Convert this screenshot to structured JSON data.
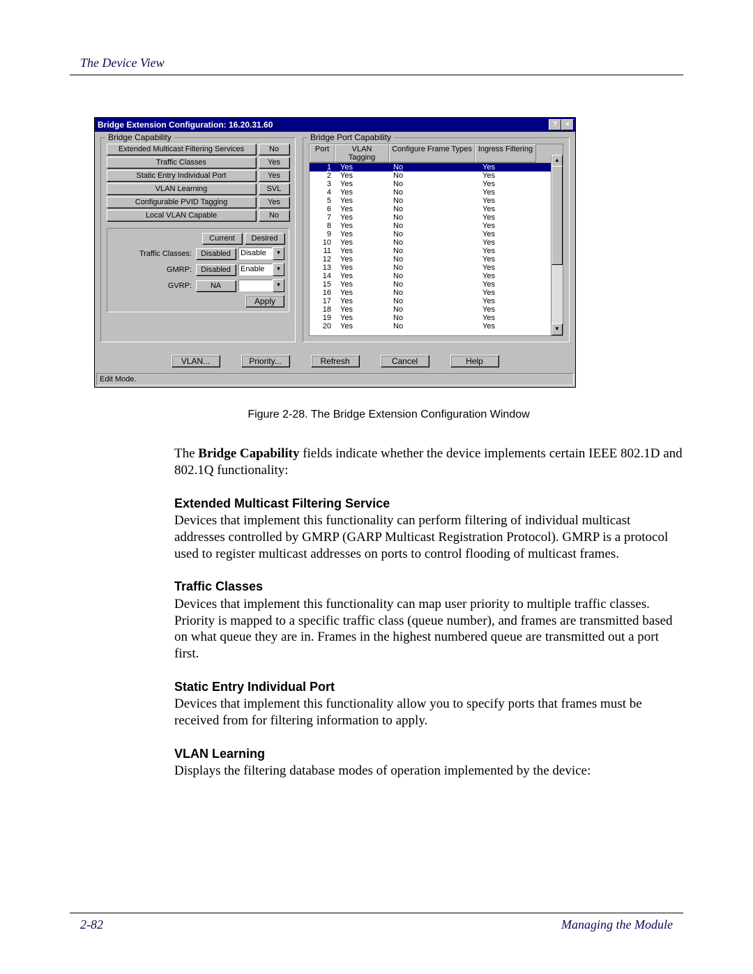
{
  "header": "The Device View",
  "window": {
    "title": "Bridge Extension Configuration: 16.20.31.60",
    "help_btn": "?",
    "close_btn": "×",
    "left_group": "Bridge Capability",
    "right_group": "Bridge Port Capability",
    "capabilities": [
      {
        "label": "Extended Multicast Filtering Services",
        "value": "No"
      },
      {
        "label": "Traffic Classes",
        "value": "Yes"
      },
      {
        "label": "Static Entry Individual Port",
        "value": "Yes"
      },
      {
        "label": "VLAN Learning",
        "value": "SVL"
      },
      {
        "label": "Configurable PVID Tagging",
        "value": "Yes"
      },
      {
        "label": "Local VLAN Capable",
        "value": "No"
      }
    ],
    "settings_hdr_current": "Current",
    "settings_hdr_desired": "Desired",
    "settings": [
      {
        "label": "Traffic Classes:",
        "current": "Disabled",
        "desired": "Disable"
      },
      {
        "label": "GMRP:",
        "current": "Disabled",
        "desired": "Enable"
      },
      {
        "label": "GVRP:",
        "current": "NA",
        "desired": ""
      }
    ],
    "apply_btn": "Apply",
    "port_headers": {
      "port": "Port",
      "tag": "VLAN Tagging",
      "cfg": "Configure Frame Types",
      "ing": "Ingress Filtering"
    },
    "ports": [
      {
        "port": "1",
        "tag": "Yes",
        "cfg": "No",
        "ing": "Yes",
        "selected": true
      },
      {
        "port": "2",
        "tag": "Yes",
        "cfg": "No",
        "ing": "Yes"
      },
      {
        "port": "3",
        "tag": "Yes",
        "cfg": "No",
        "ing": "Yes"
      },
      {
        "port": "4",
        "tag": "Yes",
        "cfg": "No",
        "ing": "Yes"
      },
      {
        "port": "5",
        "tag": "Yes",
        "cfg": "No",
        "ing": "Yes"
      },
      {
        "port": "6",
        "tag": "Yes",
        "cfg": "No",
        "ing": "Yes"
      },
      {
        "port": "7",
        "tag": "Yes",
        "cfg": "No",
        "ing": "Yes"
      },
      {
        "port": "8",
        "tag": "Yes",
        "cfg": "No",
        "ing": "Yes"
      },
      {
        "port": "9",
        "tag": "Yes",
        "cfg": "No",
        "ing": "Yes"
      },
      {
        "port": "10",
        "tag": "Yes",
        "cfg": "No",
        "ing": "Yes"
      },
      {
        "port": "11",
        "tag": "Yes",
        "cfg": "No",
        "ing": "Yes"
      },
      {
        "port": "12",
        "tag": "Yes",
        "cfg": "No",
        "ing": "Yes"
      },
      {
        "port": "13",
        "tag": "Yes",
        "cfg": "No",
        "ing": "Yes"
      },
      {
        "port": "14",
        "tag": "Yes",
        "cfg": "No",
        "ing": "Yes"
      },
      {
        "port": "15",
        "tag": "Yes",
        "cfg": "No",
        "ing": "Yes"
      },
      {
        "port": "16",
        "tag": "Yes",
        "cfg": "No",
        "ing": "Yes"
      },
      {
        "port": "17",
        "tag": "Yes",
        "cfg": "No",
        "ing": "Yes"
      },
      {
        "port": "18",
        "tag": "Yes",
        "cfg": "No",
        "ing": "Yes"
      },
      {
        "port": "19",
        "tag": "Yes",
        "cfg": "No",
        "ing": "Yes"
      },
      {
        "port": "20",
        "tag": "Yes",
        "cfg": "No",
        "ing": "Yes"
      }
    ],
    "buttons": {
      "vlan": "VLAN...",
      "priority": "Priority...",
      "refresh": "Refresh",
      "cancel": "Cancel",
      "help": "Help"
    },
    "status": "Edit Mode."
  },
  "figure_caption": "Figure 2-28. The Bridge Extension Configuration Window",
  "text": {
    "intro1": "The ",
    "intro_bold": "Bridge Capability",
    "intro2": " fields indicate whether the device implements certain IEEE 802.1D and 802.1Q functionality:",
    "h1": "Extended Multicast Filtering Service",
    "p1": "Devices that implement this functionality can perform filtering of individual multicast addresses controlled by GMRP (GARP Multicast Registration Protocol). GMRP is a protocol used to register multicast addresses on ports to control flooding of multicast frames.",
    "h2": "Traffic Classes",
    "p2": "Devices that implement this functionality can map user priority to multiple traffic classes. Priority is mapped to a specific traffic class (queue number), and frames are transmitted based on what queue they are in. Frames in the highest numbered queue are transmitted out a port first.",
    "h3": "Static Entry Individual Port",
    "p3": "Devices that implement this functionality allow you to specify ports that frames must be received from for filtering information to apply.",
    "h4": "VLAN Learning",
    "p4": "Displays the filtering database modes of operation implemented by the device:"
  },
  "footer": {
    "page": "2-82",
    "title": "Managing the Module"
  }
}
